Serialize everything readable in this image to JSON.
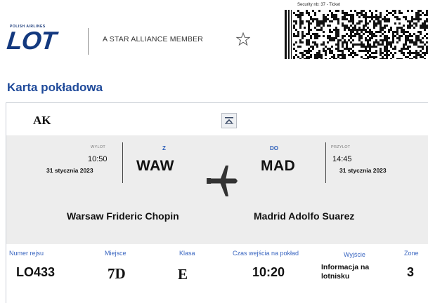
{
  "header": {
    "logo_small": "POLISH AIRLINES",
    "logo_main": "LOT",
    "alliance_text": "A STAR ALLIANCE MEMBER",
    "barcode_caption": "Security nb: 37 - Ticket"
  },
  "title": "Karta pokładowa",
  "passenger": "AK",
  "route": {
    "departure": {
      "label": "WYLOT",
      "time": "10:50",
      "date": "31 stycznia 2023",
      "from_label": "Z",
      "code": "WAW",
      "airport": "Warsaw Frideric Chopin"
    },
    "arrival": {
      "label": "PRZYLOT",
      "time": "14:45",
      "date": "31 stycznia 2023",
      "to_label": "DO",
      "code": "MAD",
      "airport": "Madrid Adolfo Suarez"
    }
  },
  "details": {
    "flight_label": "Numer rejsu",
    "flight_value": "LO433",
    "seat_label": "Miejsce",
    "seat_value": "7D",
    "class_label": "Klasa",
    "class_value": "E",
    "boarding_label": "Czas wejścia na pokład",
    "boarding_value": "10:20",
    "gate_label": "Wyjście",
    "gate_value": "Informacja na lotnisku",
    "zone_label": "Zone",
    "zone_value": "3"
  },
  "colors": {
    "brand_blue": "#13397f",
    "title_blue": "#1f4a9a",
    "label_blue": "#3a66c0",
    "route_bg": "#ededed"
  },
  "icons": {
    "star": "star-alliance-icon",
    "plane": "airplane-icon",
    "collapse": "collapse-icon",
    "barcode": "barcode-icon"
  }
}
